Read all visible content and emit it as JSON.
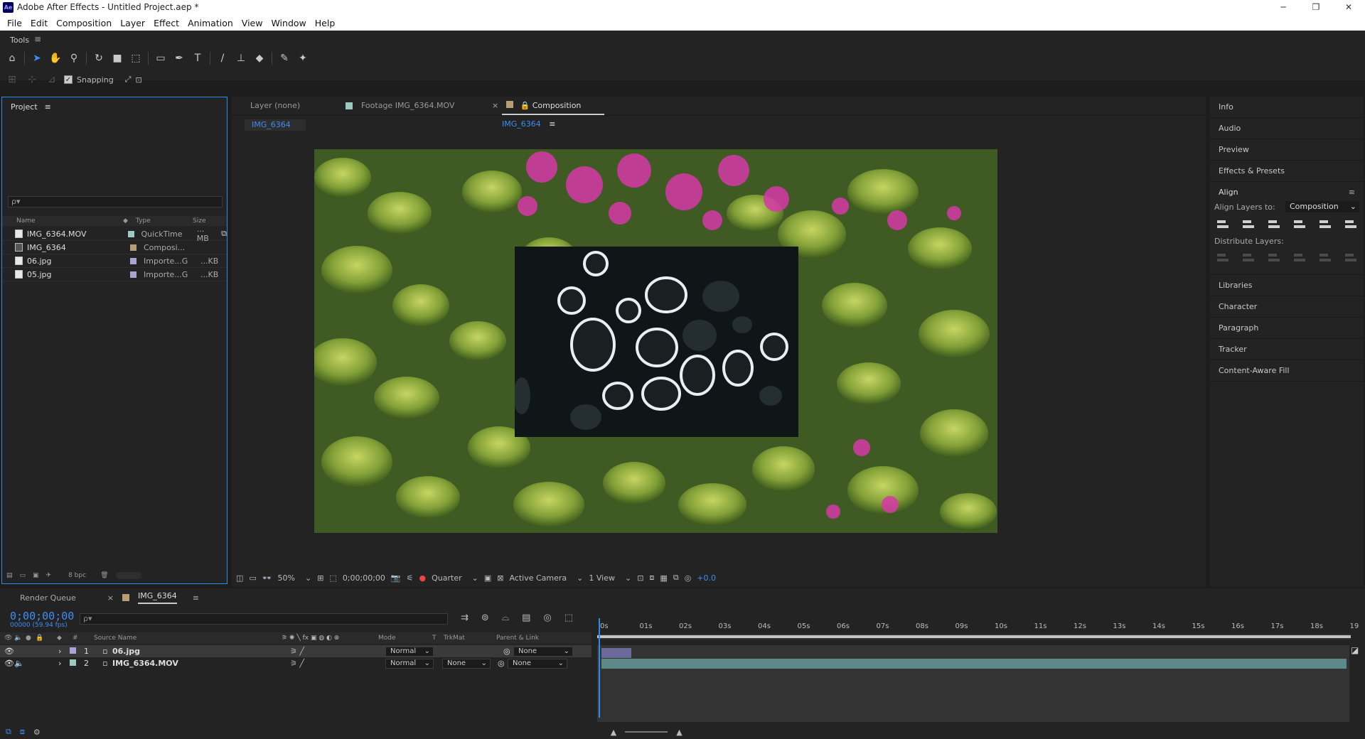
{
  "window": {
    "title": "Adobe After Effects - Untitled Project.aep *",
    "app_icon": "Ae"
  },
  "menu": [
    "File",
    "Edit",
    "Composition",
    "Layer",
    "Effect",
    "Animation",
    "View",
    "Window",
    "Help"
  ],
  "tools": {
    "label": "Tools",
    "snapping_label": "Snapping"
  },
  "project": {
    "title": "Project",
    "search_placeholder": "ρ▾",
    "columns": {
      "name": "Name",
      "type": "Type",
      "size": "Size"
    },
    "items": [
      {
        "name": "IMG_6364.MOV",
        "type": "QuickTime",
        "size": "... MB",
        "color": "#9ec9c0"
      },
      {
        "name": "IMG_6364",
        "type": "Composi...",
        "size": "",
        "color": "#b79d74"
      },
      {
        "name": "06.jpg",
        "type": "Importe...G",
        "size": "...KB",
        "color": "#a9a3d6"
      },
      {
        "name": "05.jpg",
        "type": "Importe...G",
        "size": "...KB",
        "color": "#a9a3d6"
      }
    ],
    "bpc": "8 bpc"
  },
  "viewer": {
    "tabs": {
      "layer": "Layer (none)",
      "footage": "Footage IMG_6364.MOV",
      "composition_prefix": "Composition",
      "composition_name": "IMG_6364"
    },
    "comp_chip": "IMG_6364",
    "footer": {
      "zoom": "50%",
      "timecode": "0;00;00;00",
      "resolution": "Quarter",
      "camera": "Active Camera",
      "views": "1 View",
      "exposure": "+0.0"
    }
  },
  "right_panels": {
    "items_top": [
      "Info",
      "Audio",
      "Preview",
      "Effects & Presets"
    ],
    "align": {
      "title": "Align",
      "align_to_label": "Align Layers to:",
      "align_to_value": "Composition",
      "distribute_label": "Distribute Layers:"
    },
    "items_bottom": [
      "Libraries",
      "Character",
      "Paragraph",
      "Tracker",
      "Content-Aware Fill"
    ]
  },
  "timeline": {
    "tabs": {
      "render_queue": "Render Queue",
      "comp": "IMG_6364"
    },
    "timecode": "0;00;00;00",
    "timecode_sub": "00000 (59.94 fps)",
    "search_placeholder": "ρ▾",
    "columns": {
      "num": "#",
      "source": "Source Name",
      "mode": "Mode",
      "t": "T",
      "trkmat": "TrkMat",
      "parent": "Parent & Link"
    },
    "layers": [
      {
        "num": "1",
        "name": "06.jpg",
        "mode": "Normal",
        "trkmat": "",
        "parent": "None",
        "color": "#a9a3d6"
      },
      {
        "num": "2",
        "name": "IMG_6364.MOV",
        "mode": "Normal",
        "trkmat": "None",
        "parent": "None",
        "color": "#9ec9c0"
      }
    ],
    "ruler": [
      "0s",
      "01s",
      "02s",
      "03s",
      "04s",
      "05s",
      "06s",
      "07s",
      "08s",
      "09s",
      "10s",
      "11s",
      "12s",
      "13s",
      "14s",
      "15s",
      "16s",
      "17s",
      "18s",
      "19"
    ]
  }
}
